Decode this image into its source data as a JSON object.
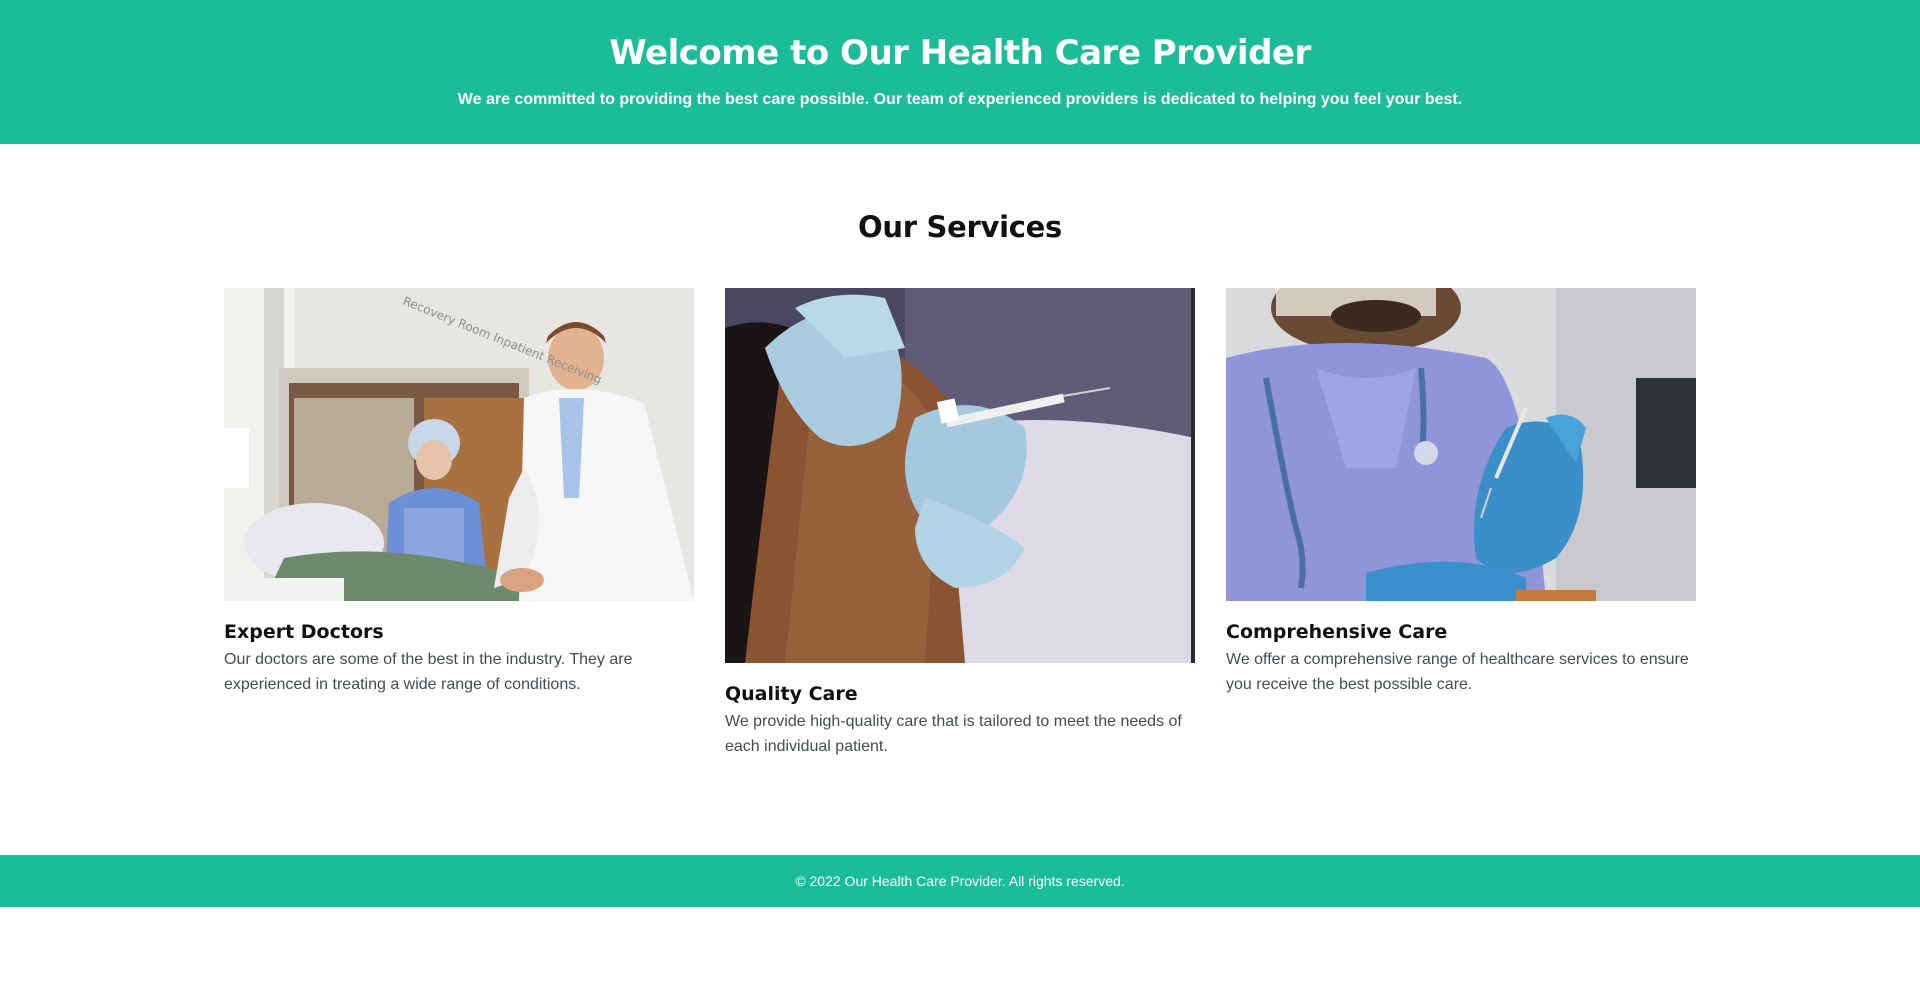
{
  "header": {
    "title": "Welcome to Our Health Care Provider",
    "subtitle": "We are committed to providing the best care possible. Our team of experienced providers is dedicated to helping you feel your best."
  },
  "services": {
    "heading": "Our Services",
    "cards": [
      {
        "title": "Expert Doctors",
        "text": "Our doctors are some of the best in the industry. They are experienced in treating a wide range of conditions.",
        "photo_sign": "Recovery Room Inpatient Receiving"
      },
      {
        "title": "Quality Care",
        "text": "We provide high-quality care that is tailored to meet the needs of each individual patient."
      },
      {
        "title": "Comprehensive Care",
        "text": "We offer a comprehensive range of healthcare services to ensure you receive the best possible care."
      }
    ]
  },
  "footer": {
    "text": "© 2022 Our Health Care Provider. All rights reserved."
  },
  "colors": {
    "accent": "#1bbd98",
    "body_text": "#444b55",
    "heading": "#111111"
  }
}
